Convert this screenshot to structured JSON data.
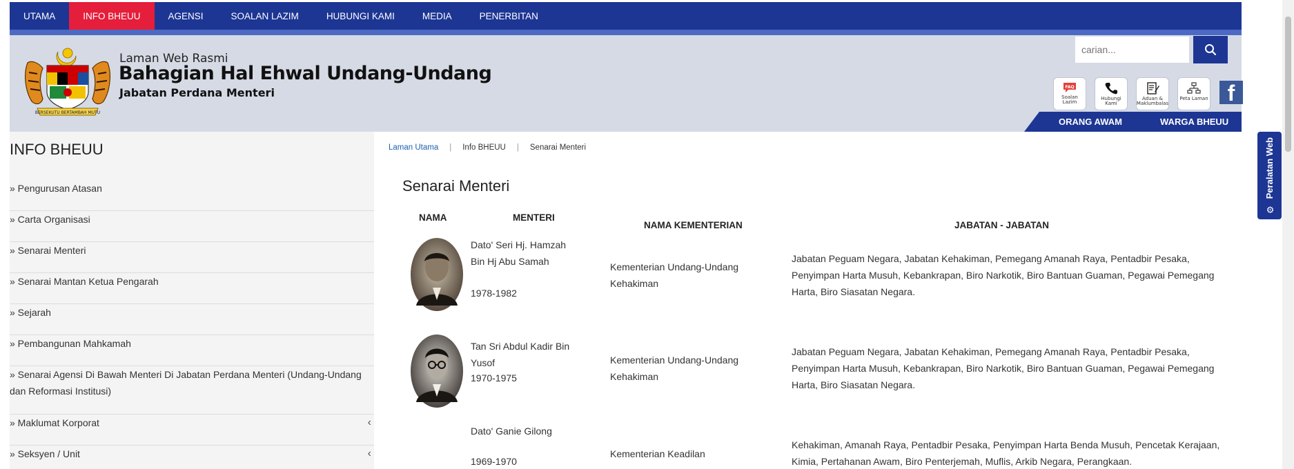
{
  "nav": {
    "items": [
      "UTAMA",
      "INFO BHEUU",
      "AGENSI",
      "SOALAN LAZIM",
      "HUBUNGI KAMI",
      "MEDIA",
      "PENERBITAN"
    ],
    "active_index": 1
  },
  "header": {
    "subtitle": "Laman Web Rasmi",
    "title": "Bahagian Hal Ehwal Undang-Undang",
    "department": "Jabatan Perdana Menteri",
    "crest_scroll_text": "BERSEKUTU BERTAMBAH MUTU"
  },
  "search": {
    "placeholder": "carian..."
  },
  "quick_links": [
    {
      "label": "Soalan Lazim",
      "icon": "faq-icon"
    },
    {
      "label": "Hubungi Kami",
      "icon": "phone-icon"
    },
    {
      "label": "Aduan & Maklumbalas",
      "icon": "feedback-icon"
    },
    {
      "label": "Peta Laman",
      "icon": "sitemap-icon"
    }
  ],
  "social": {
    "facebook": "f"
  },
  "audience": {
    "public": "ORANG AWAM",
    "staff": "WARGA BHEUU"
  },
  "sidebar": {
    "title": "INFO BHEUU",
    "items": [
      "» Pengurusan Atasan",
      "» Carta Organisasi",
      "» Senarai Menteri",
      "» Senarai Mantan Ketua Pengarah",
      "» Sejarah",
      "» Pembangunan Mahkamah",
      "» Senarai Agensi Di Bawah Menteri Di Jabatan Perdana Menteri (Undang-Undang dan Reformasi Institusi)",
      "» Maklumat Korporat",
      "» Seksyen / Unit"
    ]
  },
  "breadcrumb": {
    "home": "Laman Utama",
    "section": "Info BHEUU",
    "current": "Senarai Menteri"
  },
  "page": {
    "title": "Senarai Menteri"
  },
  "table": {
    "headers": {
      "name": "NAMA",
      "minister": "MENTERI",
      "ministry": "NAMA KEMENTERIAN",
      "departments": "JABATAN - JABATAN"
    },
    "rows": [
      {
        "name": "Dato' Seri Hj. Hamzah Bin Hj Abu Samah",
        "years": "1978-1982",
        "ministry": "Kementerian Undang-Undang Kehakiman",
        "departments": "Jabatan Peguam Negara, Jabatan Kehakiman, Pemegang Amanah Raya, Pentadbir Pesaka, Penyimpan Harta Musuh, Kebankrapan, Biro Narkotik, Biro Bantuan Guaman, Pegawai Pemegang Harta, Biro Siasatan Negara."
      },
      {
        "name": "Tan Sri Abdul Kadir Bin Yusof",
        "years": "1970-1975",
        "ministry": "Kementerian Undang-Undang Kehakiman",
        "departments": "Jabatan Peguam Negara, Jabatan Kehakiman, Pemegang Amanah Raya, Pentadbir Pesaka, Penyimpan Harta Musuh, Kebankrapan, Biro Narkotik, Biro Bantuan Guaman, Pegawai Pemegang Harta, Biro Siasatan Negara."
      },
      {
        "name": "Dato' Ganie Gilong",
        "years": "1969-1970",
        "ministry": "Kementerian Keadilan",
        "departments": "Kehakiman, Amanah Raya, Pentadbir Pesaka, Penyimpan Harta Benda Musuh, Pencetak Kerajaan, Kimia, Pertahanan Awam, Biro Penterjemah, Muflis, Arkib Negara, Perangkaan."
      }
    ]
  },
  "side_widget": {
    "label": "Peralatan Web"
  },
  "colors": {
    "nav": "#1d3694",
    "active": "#e41e3b",
    "header_bg": "#d6dae5",
    "link": "#1d5fb0"
  }
}
